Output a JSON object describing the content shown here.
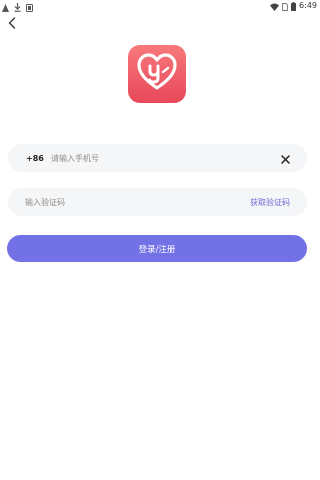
{
  "status_bar": {
    "time": "6:49",
    "icons_left": [
      "notification-icon",
      "download-icon",
      "app-icon"
    ],
    "icons_right": [
      "wifi-icon",
      "sim-icon",
      "battery-icon"
    ]
  },
  "header": {
    "back_icon": "chevron-left-icon"
  },
  "logo": {
    "icon": "heart-y-logo",
    "colors": {
      "top": "#f8797c",
      "bottom": "#e7485a"
    }
  },
  "phone": {
    "country_code": "+86",
    "placeholder": "请输入手机号",
    "value": "",
    "clear_icon": "close-icon"
  },
  "code": {
    "placeholder": "输入验证码",
    "value": "",
    "get_code_label": "获取验证码"
  },
  "login": {
    "label": "登录/注册"
  },
  "colors": {
    "accent": "#7271e6",
    "link": "#6d6ad6",
    "field_bg": "#f5f6f8"
  }
}
